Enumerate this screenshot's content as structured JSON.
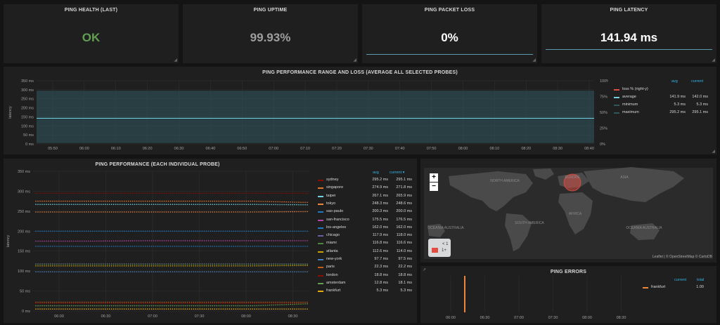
{
  "stats": {
    "health": {
      "title": "PING HEALTH (LAST)",
      "value": "OK",
      "color": "#629e51"
    },
    "uptime": {
      "title": "PING UPTIME",
      "value": "99.93%",
      "color": "#9e9e9e"
    },
    "loss": {
      "title": "PING PACKET LOSS",
      "value": "0%",
      "color": "#ffffff"
    },
    "latency": {
      "title": "PING LATENCY",
      "value": "141.94 ms",
      "color": "#ffffff"
    }
  },
  "range_panel": {
    "title": "PING PERFORMANCE RANGE AND LOSS (AVERAGE ALL SELECTED PROBES)",
    "ylabel": "latency",
    "y_ticks": [
      "350 ms",
      "300 ms",
      "250 ms",
      "200 ms",
      "150 ms",
      "100 ms",
      "50 ms",
      "0 ms"
    ],
    "y2_ticks": [
      "100%",
      "75%",
      "50%",
      "25%",
      "0%"
    ],
    "x_ticks": [
      "05:50",
      "06:00",
      "06:10",
      "06:20",
      "06:30",
      "06:40",
      "06:50",
      "07:00",
      "07:10",
      "07:20",
      "07:30",
      "07:40",
      "07:50",
      "08:00",
      "08:10",
      "08:20",
      "08:30",
      "08:40"
    ],
    "legend_head": {
      "avg": "avg",
      "current": "current"
    },
    "legend": [
      {
        "name": "loss % (right-y)",
        "avg": "",
        "current": "",
        "color": "#e24d42"
      },
      {
        "name": "average",
        "avg": "141.9 ms",
        "current": "142.0 ms",
        "color": "#6ed0e0"
      },
      {
        "name": "minimum",
        "avg": "5.3 ms",
        "current": "5.3 ms",
        "color": "#2f575e"
      },
      {
        "name": "maximum",
        "avg": "295.2 ms",
        "current": "295.1 ms",
        "color": "#2f575e"
      }
    ]
  },
  "probe_panel": {
    "title": "PING PERFORMANCE (EACH INDIVIDUAL PROBE)",
    "ylabel": "latency",
    "y_ticks": [
      "350 ms",
      "300 ms",
      "250 ms",
      "200 ms",
      "150 ms",
      "100 ms",
      "50 ms",
      "0 ms"
    ],
    "x_ticks": [
      "06:00",
      "06:30",
      "07:00",
      "07:30",
      "08:00",
      "08:30"
    ],
    "legend_head": {
      "avg": "avg",
      "current": "current ▾"
    },
    "legend": [
      {
        "name": "sydney",
        "avg": "295.2 ms",
        "current": "295.1 ms",
        "color": "#890f02"
      },
      {
        "name": "singapore",
        "avg": "274.9 ms",
        "current": "271.8 ms",
        "color": "#e0752d"
      },
      {
        "name": "taipei",
        "avg": "267.1 ms",
        "current": "265.9 ms",
        "color": "#6ed0e0"
      },
      {
        "name": "tokyo",
        "avg": "248.3 ms",
        "current": "248.6 ms",
        "color": "#ef843c"
      },
      {
        "name": "sao-paulo",
        "avg": "200.3 ms",
        "current": "200.0 ms",
        "color": "#1f78c1"
      },
      {
        "name": "san-francisco",
        "avg": "175.5 ms",
        "current": "176.5 ms",
        "color": "#ba43a9"
      },
      {
        "name": "los-angeles",
        "avg": "162.0 ms",
        "current": "162.0 ms",
        "color": "#1f78c1"
      },
      {
        "name": "chicago",
        "avg": "117.9 ms",
        "current": "118.0 ms",
        "color": "#705da0"
      },
      {
        "name": "miami",
        "avg": "116.8 ms",
        "current": "116.6 ms",
        "color": "#508642"
      },
      {
        "name": "atlanta",
        "avg": "112.6 ms",
        "current": "114.0 ms",
        "color": "#cca300"
      },
      {
        "name": "new-york",
        "avg": "97.7 ms",
        "current": "97.5 ms",
        "color": "#447ebc"
      },
      {
        "name": "paris",
        "avg": "22.3 ms",
        "current": "22.2 ms",
        "color": "#c15c17"
      },
      {
        "name": "london",
        "avg": "18.8 ms",
        "current": "18.8 ms",
        "color": "#890f02"
      },
      {
        "name": "amsterdam",
        "avg": "12.8 ms",
        "current": "18.1 ms",
        "color": "#629e51"
      },
      {
        "name": "frankfurt",
        "avg": "5.3 ms",
        "current": "5.3 ms",
        "color": "#e5ac0e"
      }
    ]
  },
  "map_panel": {
    "zoom_in": "+",
    "zoom_out": "−",
    "labels": {
      "na": "NORTH AMERICA",
      "sa": "SOUTH AMERICA",
      "eu": "EUROPE",
      "af": "AFRICA",
      "asia": "ASIA",
      "oceania_left": "OCEANIA AUSTRALIA",
      "oceania_right": "OCEANIA AUSTRALIA"
    },
    "legend": [
      {
        "label": "< 1"
      },
      {
        "label": "1+"
      }
    ],
    "attribution": "Leaflet | © OpenStreetMap © CartoDB"
  },
  "errors_panel": {
    "title": "PING ERRORS",
    "x_ticks": [
      "06:00",
      "06:30",
      "07:00",
      "07:30",
      "08:00",
      "08:30"
    ],
    "legend_head": {
      "current": "current",
      "total": "total"
    },
    "legend": [
      {
        "name": "frankfurt",
        "current": "",
        "total": "1.00",
        "color": "#ef843c"
      }
    ]
  },
  "chart_data": [
    {
      "type": "line",
      "title": "PING PERFORMANCE RANGE AND LOSS (AVERAGE ALL SELECTED PROBES)",
      "ylabel": "latency",
      "ylim": [
        0,
        350
      ],
      "x": [
        "05:50",
        "06:00",
        "06:10",
        "06:20",
        "06:30",
        "06:40",
        "06:50",
        "07:00",
        "07:10",
        "07:20",
        "07:30",
        "07:40",
        "07:50",
        "08:00",
        "08:10",
        "08:20",
        "08:30",
        "08:40"
      ],
      "series": [
        {
          "name": "maximum",
          "values": [
            295,
            295,
            295,
            295,
            295,
            295,
            295,
            295,
            295,
            295,
            295,
            295,
            295,
            295,
            295,
            295,
            295,
            295
          ]
        },
        {
          "name": "average",
          "values": [
            142,
            142,
            142,
            142,
            142,
            142,
            142,
            142,
            142,
            142,
            142,
            142,
            142,
            142,
            142,
            142,
            142,
            142
          ]
        },
        {
          "name": "minimum",
          "values": [
            5,
            5,
            5,
            5,
            5,
            5,
            5,
            5,
            5,
            5,
            5,
            5,
            5,
            5,
            5,
            5,
            5,
            5
          ]
        },
        {
          "name": "loss % (right-y)",
          "values": [
            0,
            0,
            0,
            0,
            0,
            0,
            0,
            0,
            0,
            0,
            0,
            0,
            0,
            0,
            0,
            0,
            0,
            0
          ]
        }
      ]
    },
    {
      "type": "scatter",
      "title": "PING PERFORMANCE (EACH INDIVIDUAL PROBE)",
      "ylabel": "latency",
      "ylim": [
        0,
        350
      ],
      "x": [
        "06:00",
        "06:30",
        "07:00",
        "07:30",
        "08:00",
        "08:30"
      ],
      "series": [
        {
          "name": "sydney",
          "values": [
            295,
            295,
            295,
            295,
            295,
            295
          ]
        },
        {
          "name": "singapore",
          "values": [
            275,
            275,
            275,
            275,
            275,
            272
          ]
        },
        {
          "name": "taipei",
          "values": [
            267,
            267,
            267,
            267,
            267,
            266
          ]
        },
        {
          "name": "tokyo",
          "values": [
            248,
            248,
            248,
            248,
            248,
            249
          ]
        },
        {
          "name": "sao-paulo",
          "values": [
            200,
            200,
            200,
            200,
            200,
            200
          ]
        },
        {
          "name": "san-francisco",
          "values": [
            175,
            175,
            176,
            176,
            176,
            176
          ]
        },
        {
          "name": "los-angeles",
          "values": [
            162,
            162,
            162,
            162,
            162,
            162
          ]
        },
        {
          "name": "chicago",
          "values": [
            118,
            118,
            118,
            118,
            118,
            118
          ]
        },
        {
          "name": "miami",
          "values": [
            117,
            117,
            117,
            117,
            117,
            117
          ]
        },
        {
          "name": "atlanta",
          "values": [
            113,
            113,
            113,
            113,
            113,
            114
          ]
        },
        {
          "name": "new-york",
          "values": [
            98,
            98,
            98,
            98,
            98,
            98
          ]
        },
        {
          "name": "paris",
          "values": [
            22,
            22,
            22,
            22,
            22,
            22
          ]
        },
        {
          "name": "london",
          "values": [
            19,
            19,
            19,
            19,
            19,
            19
          ]
        },
        {
          "name": "amsterdam",
          "values": [
            13,
            13,
            13,
            13,
            13,
            18
          ]
        },
        {
          "name": "frankfurt",
          "values": [
            5,
            5,
            5,
            5,
            5,
            5
          ]
        }
      ]
    },
    {
      "type": "bar",
      "title": "PING ERRORS",
      "x": [
        "06:00",
        "06:30",
        "07:00",
        "07:30",
        "08:00",
        "08:30"
      ],
      "series": [
        {
          "name": "frankfurt",
          "values": [
            1,
            0,
            0,
            0,
            0,
            0
          ]
        }
      ]
    }
  ]
}
